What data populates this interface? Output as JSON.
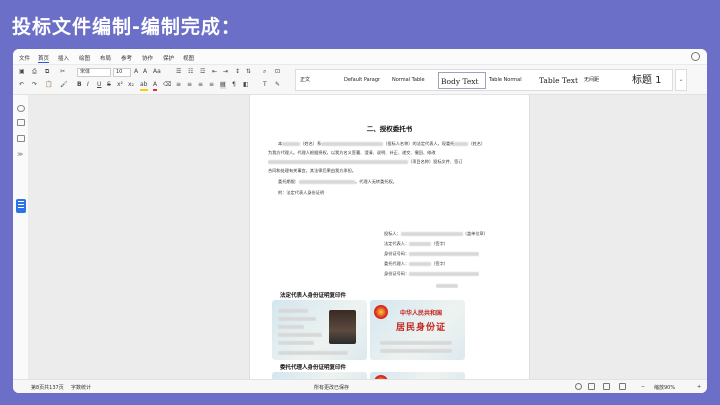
{
  "slide": {
    "title": "投标文件编制-编制完成："
  },
  "menu": {
    "items": [
      "文件",
      "首页",
      "插入",
      "绘图",
      "布局",
      "参考",
      "协作",
      "保护",
      "视图"
    ],
    "active_index": 1
  },
  "toolbar": {
    "font_name": "宋体",
    "font_size": "10",
    "styles": [
      "正文",
      "Default Paragr",
      "Normal Table",
      "Body Text",
      "Table Normal",
      "Table Text",
      "无间距",
      "标题 1"
    ]
  },
  "document": {
    "title": "二、授权委托书",
    "p1_start": "本",
    "p1_a": "（姓名）系",
    "p1_b": "（投标人名称）的法定代表人，现委托",
    "p1_c": "（姓名）",
    "p2": "为我方代理人。代理人根据授权，以我方名义签署、澄清、说明、补正、递交、撤回、修改",
    "p3_b": "（项目名称）",
    "p3_c": "投标文件、签订",
    "p4": "合同和处理有关事宜，其法律后果由我方承担。",
    "p5_a": "委托期限：",
    "p5_b": "。代理人无转委托权。",
    "p6": "附：法定代表人身份证明",
    "sig": [
      {
        "label": "投标人：",
        "suffix": "（盖单位章）"
      },
      {
        "label": "法定代表人：",
        "suffix": "（签字）"
      },
      {
        "label": "身份证号码：",
        "suffix": ""
      },
      {
        "label": "委托代理人：",
        "suffix": "（签字）"
      },
      {
        "label": "身份证号码：",
        "suffix": ""
      }
    ],
    "section1": "法定代表人身份证明复印件",
    "section2": "委托代理人身份证明复印件",
    "card_country": "中华人民共和国",
    "card_title": "居民身份证"
  },
  "status": {
    "page_info": "第8页共137页",
    "word_count": "字数统计",
    "save_status": "所有更改已保存",
    "zoom": "缩放90%"
  }
}
